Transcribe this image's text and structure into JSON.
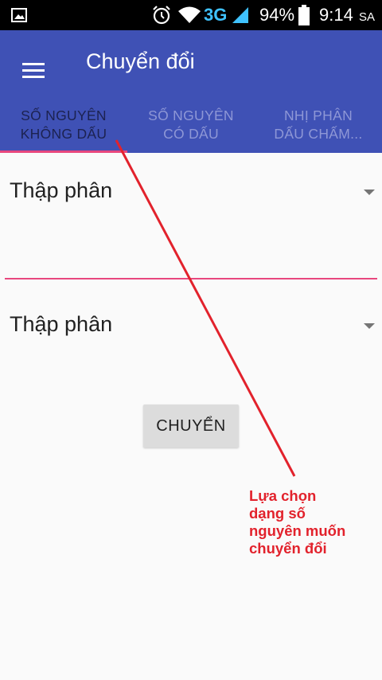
{
  "status_bar": {
    "image_icon": "image-icon",
    "alarm_icon": "alarm-icon",
    "wifi_icon": "wifi-icon",
    "network_type": "3G",
    "signal_icon": "signal-icon",
    "battery_percent": "94%",
    "battery_icon": "battery-icon",
    "time": "9:14",
    "am_pm": "SA"
  },
  "app_bar": {
    "menu_icon": "hamburger-menu-icon",
    "title": "Chuyển đổi",
    "color": "#3f51b5"
  },
  "tabs": [
    {
      "line1": "SỐ NGUYÊN",
      "line2": "KHÔNG DẤU",
      "active": true
    },
    {
      "line1": "SỐ NGUYÊN",
      "line2": "CÓ DẤU",
      "active": false
    },
    {
      "line1": "NHỊ PHÂN",
      "line2": "DẤU CHẤM...",
      "active": false
    }
  ],
  "form": {
    "from_spinner": {
      "selected": "Thập phân"
    },
    "to_spinner": {
      "selected": "Thập phân"
    },
    "accent_color": "#e8477e"
  },
  "convert_button": {
    "label": "CHUYỂN"
  },
  "annotation": {
    "lines": [
      "Lựa chọn",
      "dạng số",
      "nguyên muốn",
      "chuyển đổi"
    ],
    "color": "#e2222c"
  }
}
